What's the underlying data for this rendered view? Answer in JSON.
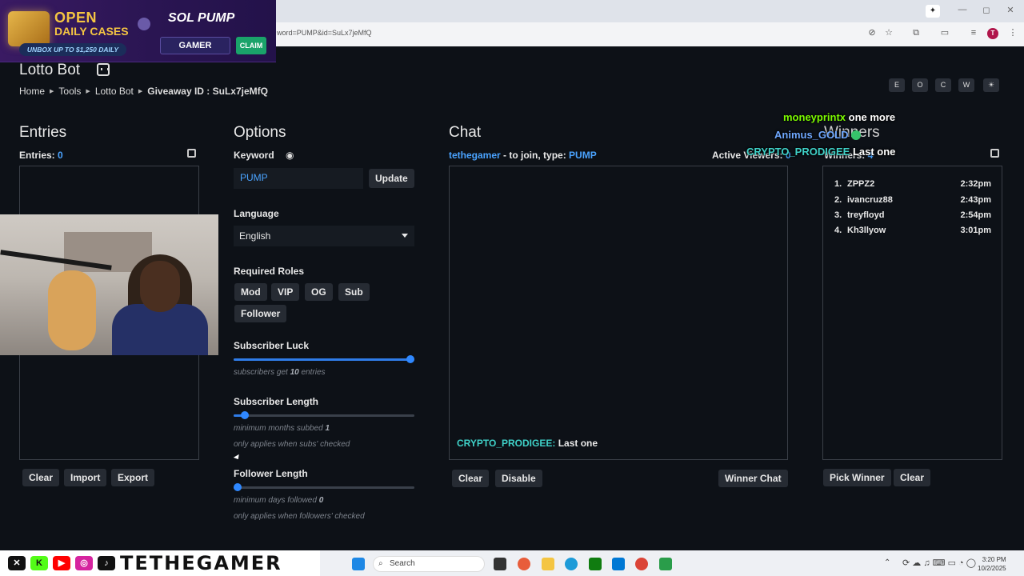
{
  "browser": {
    "url": "word=PUMP&id=SuLx7jeMfQ",
    "window_controls": [
      "—",
      "◻",
      "✕"
    ],
    "profile_initial": "T"
  },
  "ad": {
    "line1": "OPEN",
    "line2": "DAILY CASES",
    "tagline": "UNBOX UP TO $1,250 DAILY",
    "brand": "SOL PUMP",
    "code": "GAMER",
    "claim": "CLAIM"
  },
  "header": {
    "title": "Lotto Bot",
    "breadcrumb": [
      "Home",
      "Tools",
      "Lotto Bot",
      "Giveaway ID : SuLx7jeMfQ"
    ],
    "theme_buttons": [
      "E",
      "O",
      "C",
      "W",
      "☀"
    ]
  },
  "entries": {
    "title": "Entries",
    "count_label": "Entries:",
    "count": "0",
    "buttons": [
      "Clear",
      "Import",
      "Export"
    ]
  },
  "options": {
    "title": "Options",
    "keyword_label": "Keyword",
    "keyword_value": "PUMP",
    "update_label": "Update",
    "language_label": "Language",
    "language_value": "English",
    "roles_label": "Required Roles",
    "roles": [
      "Mod",
      "VIP",
      "OG",
      "Sub",
      "Follower"
    ],
    "sub_luck_label": "Subscriber Luck",
    "sub_luck_hint_pre": "subscribers get",
    "sub_luck_value": "10",
    "sub_luck_hint_post": "entries",
    "sub_length_label": "Subscriber Length",
    "sub_length_hint_pre": "minimum months subbed",
    "sub_length_value": "1",
    "sub_length_note": "only applies when subs' checked",
    "follow_length_label": "Follower Length",
    "follow_length_hint_pre": "minimum days followed",
    "follow_length_value": "0",
    "follow_length_note": "only applies when followers' checked",
    "sub_luck_level": 1.0,
    "sub_length_level": 0.04,
    "follow_length_level": 0.0
  },
  "chat": {
    "title": "Chat",
    "join_user": "tethegamer",
    "join_text": "- to join, type:",
    "join_keyword": "PUMP",
    "active_viewers_label": "Active Viewers:",
    "active_viewers": "0",
    "messages": [
      {
        "user": "CRYPTO_PRODIGEE:",
        "text": "Last one"
      }
    ],
    "buttons": {
      "clear": "Clear",
      "disable": "Disable",
      "winner_chat": "Winner Chat"
    }
  },
  "winners": {
    "title": "Winners",
    "count_label": "Winners:",
    "count": "4",
    "list": [
      {
        "n": "1.",
        "name": "ZPPZ2",
        "time": "2:32pm"
      },
      {
        "n": "2.",
        "name": "ivancruz88",
        "time": "2:43pm"
      },
      {
        "n": "3.",
        "name": "treyfloyd",
        "time": "2:54pm"
      },
      {
        "n": "4.",
        "name": "Kh3llyow",
        "time": "3:01pm"
      }
    ],
    "buttons": {
      "pick": "Pick Winner",
      "clear": "Clear"
    }
  },
  "stream_overlay": {
    "messages": [
      {
        "user": "moneyprintx",
        "text": "one more",
        "color": "#7CFC00"
      },
      {
        "user": "Animus_GOLD",
        "text": "",
        "color": "#6fa8ff"
      },
      {
        "user": "CRYPTO_PRODIGEE",
        "text": "Last one",
        "color": "#3fd1c8"
      }
    ],
    "channel": "TETHEGAMER"
  },
  "taskbar": {
    "search_placeholder": "Search",
    "time": "3:20 PM",
    "date": "10/2/2025"
  },
  "colors": {
    "accent": "#4aa3ff",
    "background": "#0d1117",
    "button": "#262b33"
  }
}
